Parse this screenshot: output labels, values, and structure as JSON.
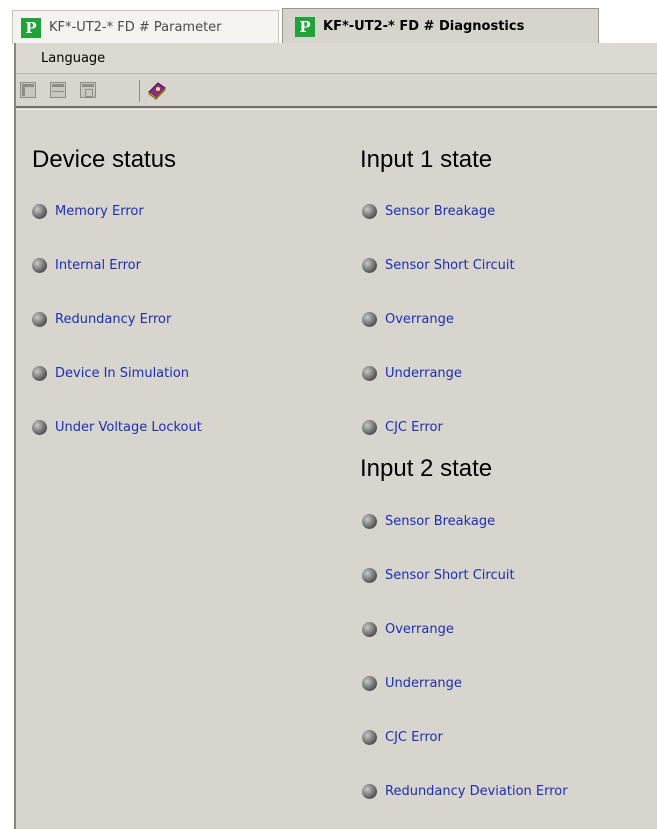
{
  "tabs": [
    {
      "label": "KF*-UT2-* FD # Parameter",
      "logo": "P+F"
    },
    {
      "label": "KF*-UT2-* FD # Diagnostics",
      "logo": "P+F"
    }
  ],
  "menu": {
    "language": "Language"
  },
  "toolbar": {
    "icons": [
      "layout-left-icon",
      "layout-bottom-icon",
      "layout-center-icon",
      "help-book-icon"
    ]
  },
  "device_status": {
    "title": "Device status",
    "items": [
      "Memory Error",
      "Internal Error",
      "Redundancy Error",
      "Device In Simulation",
      "Under Voltage Lockout"
    ]
  },
  "input1": {
    "title": "Input 1 state",
    "items": [
      "Sensor Breakage",
      "Sensor Short Circuit",
      "Overrange",
      "Underrange",
      "CJC Error"
    ]
  },
  "input2": {
    "title": "Input 2 state",
    "items": [
      "Sensor Breakage",
      "Sensor Short Circuit",
      "Overrange",
      "Underrange",
      "CJC Error",
      "Redundancy Deviation Error"
    ]
  },
  "colors": {
    "link": "#1a2fb7",
    "panel": "#d8d5ce",
    "brand": "#1fa338"
  }
}
